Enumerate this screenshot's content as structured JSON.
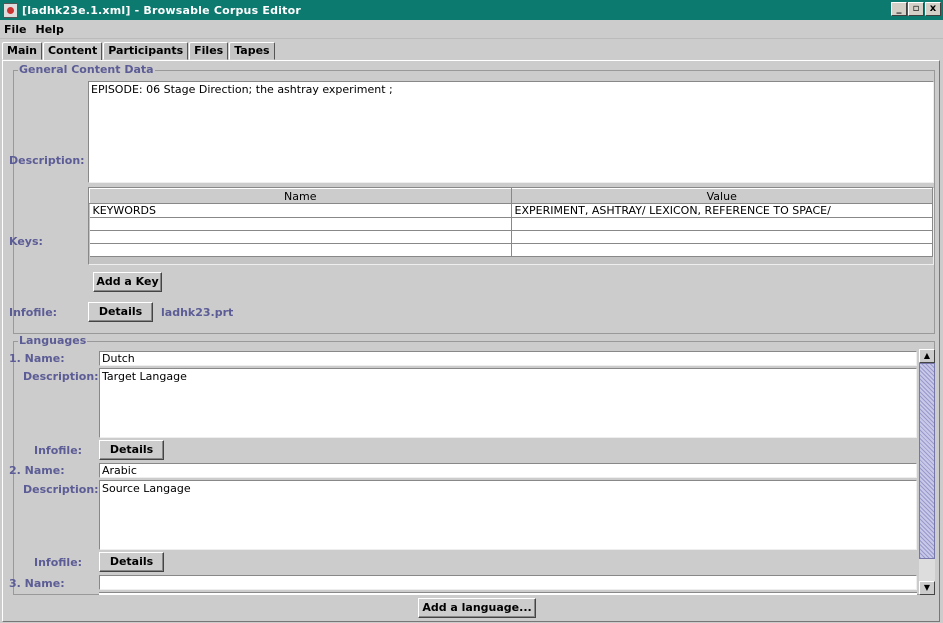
{
  "window": {
    "title": "[ladhk23e.1.xml] - Browsable Corpus Editor",
    "minimize_label": "_",
    "maximize_label": "▫",
    "close_label": "x"
  },
  "menu": {
    "items": [
      "File",
      "Help"
    ]
  },
  "tabs": [
    {
      "label": "Main",
      "active": false
    },
    {
      "label": "Content",
      "active": true
    },
    {
      "label": "Participants",
      "active": false
    },
    {
      "label": "Files",
      "active": false
    },
    {
      "label": "Tapes",
      "active": false
    }
  ],
  "general": {
    "legend": "General Content Data",
    "description_label": "Description:",
    "description_value": "EPISODE: 06 Stage Direction; the ashtray experiment ;",
    "keys_label": "Keys:",
    "keys_table": {
      "columns": [
        "Name",
        "Value"
      ],
      "rows": [
        [
          "KEYWORDS",
          "EXPERIMENT, ASHTRAY/ LEXICON, REFERENCE TO SPACE/"
        ],
        [
          "",
          ""
        ],
        [
          "",
          ""
        ],
        [
          "",
          ""
        ]
      ]
    },
    "add_key_label": "Add a Key",
    "infofile_label": "Infofile:",
    "details_label": "Details",
    "infofile_name": "ladhk23.prt"
  },
  "languages": {
    "legend": "Languages",
    "items": [
      {
        "name_label": "1. Name:",
        "name": "Dutch",
        "description_label": "Description:",
        "description": "Target Langage",
        "infofile_label": "Infofile:",
        "details_label": "Details"
      },
      {
        "name_label": "2. Name:",
        "name": "Arabic",
        "description_label": "Description:",
        "description": "Source Langage",
        "infofile_label": "Infofile:",
        "details_label": "Details"
      },
      {
        "name_label": "3. Name:",
        "name": ""
      }
    ],
    "add_language_label": "Add a language..."
  },
  "icons": {
    "scroll_up": "▲",
    "scroll_down": "▼"
  }
}
